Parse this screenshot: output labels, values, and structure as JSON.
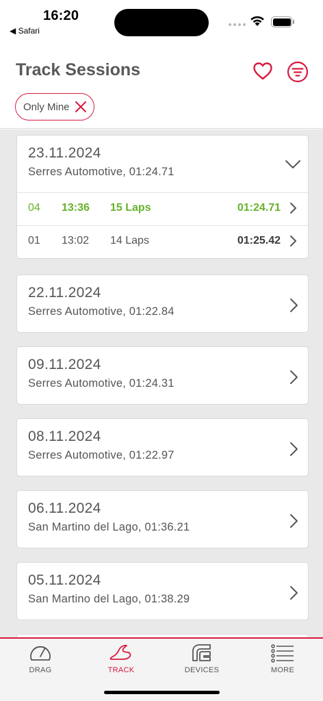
{
  "status": {
    "time": "16:20",
    "back_app": "◀ Safari"
  },
  "header": {
    "title": "Track Sessions",
    "filter_chip": {
      "label": "Only Mine"
    }
  },
  "colors": {
    "accent": "#d8193f",
    "best_lap": "#66b22a"
  },
  "cards": [
    {
      "date": "23.11.2024",
      "subtitle": "Serres Automotive, 01:24.71",
      "expanded": true,
      "sessions": [
        {
          "num": "04",
          "time": "13:36",
          "laps": "15 Laps",
          "best": "01:24.71",
          "highlight": true
        },
        {
          "num": "01",
          "time": "13:02",
          "laps": "14 Laps",
          "best": "01:25.42",
          "highlight": false
        }
      ]
    },
    {
      "date": "22.11.2024",
      "subtitle": "Serres Automotive, 01:22.84"
    },
    {
      "date": "09.11.2024",
      "subtitle": "Serres Automotive, 01:24.31"
    },
    {
      "date": "08.11.2024",
      "subtitle": "Serres Automotive, 01:22.97"
    },
    {
      "date": "06.11.2024",
      "subtitle": "San Martino del Lago, 01:36.21"
    },
    {
      "date": "05.11.2024",
      "subtitle": "San Martino del Lago, 01:38.29"
    }
  ],
  "tabs": [
    {
      "label": "DRAG",
      "icon": "gauge-icon",
      "active": false
    },
    {
      "label": "TRACK",
      "icon": "track-icon",
      "active": true
    },
    {
      "label": "DEVICES",
      "icon": "device-icon",
      "active": false
    },
    {
      "label": "MORE",
      "icon": "menu-list-icon",
      "active": false
    }
  ]
}
